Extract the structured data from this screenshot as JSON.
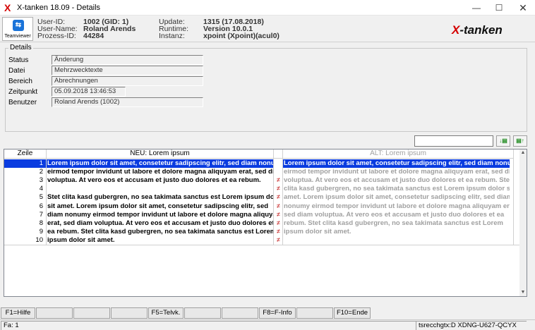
{
  "window": {
    "title": "X-tanken 18.09 - Details",
    "app_icon_glyph": "X",
    "minimize_glyph": "—",
    "maximize_glyph": "☐",
    "close_glyph": "✕"
  },
  "header": {
    "teamviewer": {
      "label": "Teamviewer",
      "icon": "teamviewer-icon",
      "icon_glyph": "⇆"
    },
    "user_id_label": "User-ID:",
    "user_id_value": "1002 (GID: 1)",
    "user_name_label": "User-Name:",
    "user_name_value": "Roland Arends",
    "process_id_label": "Prozess-ID:",
    "process_id_value": "44284",
    "update_label": "Update:",
    "update_value": "1315 (17.08.2018)",
    "runtime_label": "Runtime:",
    "runtime_value": "Version 10.0.1",
    "instanz_label": "Instanz:",
    "instanz_value": "xpoint (Xpoint)(acul0)",
    "brand_x": "X",
    "brand_rest": "-tanken"
  },
  "details": {
    "group_title": "Details",
    "fields": [
      {
        "label": "Status",
        "value": "Änderung"
      },
      {
        "label": "Datei",
        "value": "Mehrzwecktexte"
      },
      {
        "label": "Bereich",
        "value": "Abrechnungen"
      },
      {
        "label": "Zeitpunkt",
        "value": "05.09.2018 13:46:53"
      },
      {
        "label": "Benutzer",
        "value": "Roland Arends (1002)"
      }
    ]
  },
  "toolbar": {
    "search_value": "",
    "button1_glyph": "↓▤",
    "button2_glyph": "▤↑"
  },
  "table": {
    "headers": {
      "zeile": "Zeile",
      "neu": "NEU: Lorem ipsum",
      "alt": "ALT: Lorem ipsum"
    },
    "diff_mark": "≠",
    "rows": [
      {
        "num": "1",
        "neu": "Lorem ipsum dolor sit amet, consetetur sadipscing elitr, sed diam nonumy",
        "mark": "",
        "alt": "Lorem ipsum dolor sit amet, consetetur sadipscing elitr, sed diam nonumy"
      },
      {
        "num": "2",
        "neu": "eirmod tempor invidunt ut labore et dolore magna aliquyam erat, sed diam",
        "mark": "",
        "alt": "eirmod tempor invidunt ut labore et dolore magna aliquyam erat, sed diam"
      },
      {
        "num": "3",
        "neu": "voluptua. At vero eos et accusam et justo duo dolores et ea rebum.",
        "mark": "≠",
        "alt": "voluptua. At vero eos et accusam et justo duo dolores et ea rebum. Stet"
      },
      {
        "num": "4",
        "neu": "",
        "mark": "≠",
        "alt": "clita kasd gubergren, no sea takimata sanctus est Lorem ipsum dolor sit"
      },
      {
        "num": "5",
        "neu": "Stet clita kasd gubergren, no sea takimata sanctus est Lorem ipsum dolor",
        "mark": "≠",
        "alt": "amet. Lorem ipsum dolor sit amet, consetetur sadipscing elitr, sed diam"
      },
      {
        "num": "6",
        "neu": "sit amet. Lorem ipsum dolor sit amet, consetetur sadipscing elitr, sed",
        "mark": "≠",
        "alt": "nonumy eirmod tempor invidunt ut labore et dolore magna aliquyam erat,"
      },
      {
        "num": "7",
        "neu": "diam nonumy eirmod tempor invidunt ut labore et dolore magna aliquyam",
        "mark": "≠",
        "alt": "sed diam voluptua. At vero eos et accusam et justo duo dolores et ea"
      },
      {
        "num": "8",
        "neu": "erat, sed diam voluptua. At vero eos et accusam et justo duo dolores et",
        "mark": "≠",
        "alt": "rebum. Stet clita kasd gubergren, no sea takimata sanctus est Lorem"
      },
      {
        "num": "9",
        "neu": "ea rebum. Stet clita kasd gubergren, no sea takimata sanctus est Lorem",
        "mark": "≠",
        "alt": "ipsum dolor sit amet."
      },
      {
        "num": "10",
        "neu": "ipsum dolor sit amet.",
        "mark": "≠",
        "alt": ""
      }
    ],
    "selected_row": 1,
    "scroll_up_glyph": "▲",
    "scroll_down_glyph": "▼"
  },
  "fkeys": [
    "F1=Hilfe",
    "",
    "",
    "",
    "F5=Telvk.",
    "",
    "",
    "F8=F-Info",
    "",
    "F10=Ende"
  ],
  "statusbar": {
    "left": "Fa: 1",
    "right": "tsrecchgtx:D XDNG-U627-QCYX"
  },
  "colors": {
    "brand_red": "#d40000",
    "selection": "#0a3ce0",
    "diff_mark": "#b00000"
  }
}
